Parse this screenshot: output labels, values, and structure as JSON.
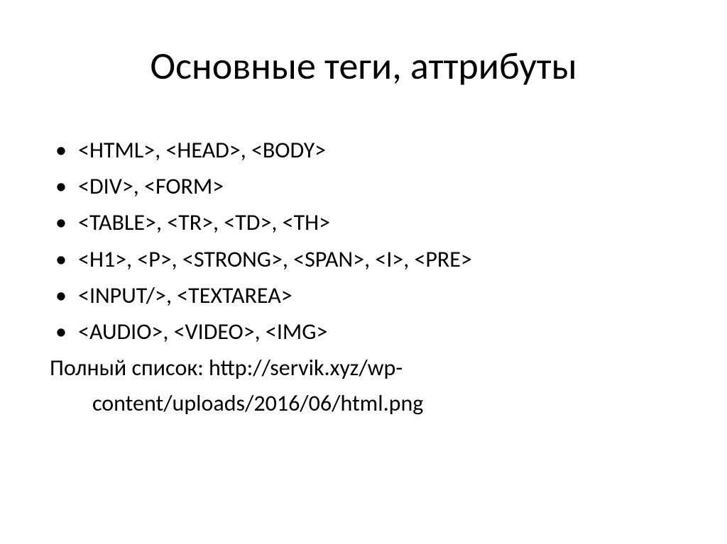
{
  "slide": {
    "title": "Основные теги, аттрибуты",
    "bullets": [
      "<HTML>, <HEAD>, <BODY>",
      "<DIV>, <FORM>",
      "<TABLE>, <TR>, <TD>, <TH>",
      "<H1>, <P>, <STRONG>, <SPAN>, <I>, <PRE>",
      "<INPUT/>, <TEXTAREA>",
      "<AUDIO>, <VIDEO>, <IMG>"
    ],
    "footer_line1": "Полный список: http://servik.xyz/wp-",
    "footer_line2": "content/uploads/2016/06/html.png"
  }
}
